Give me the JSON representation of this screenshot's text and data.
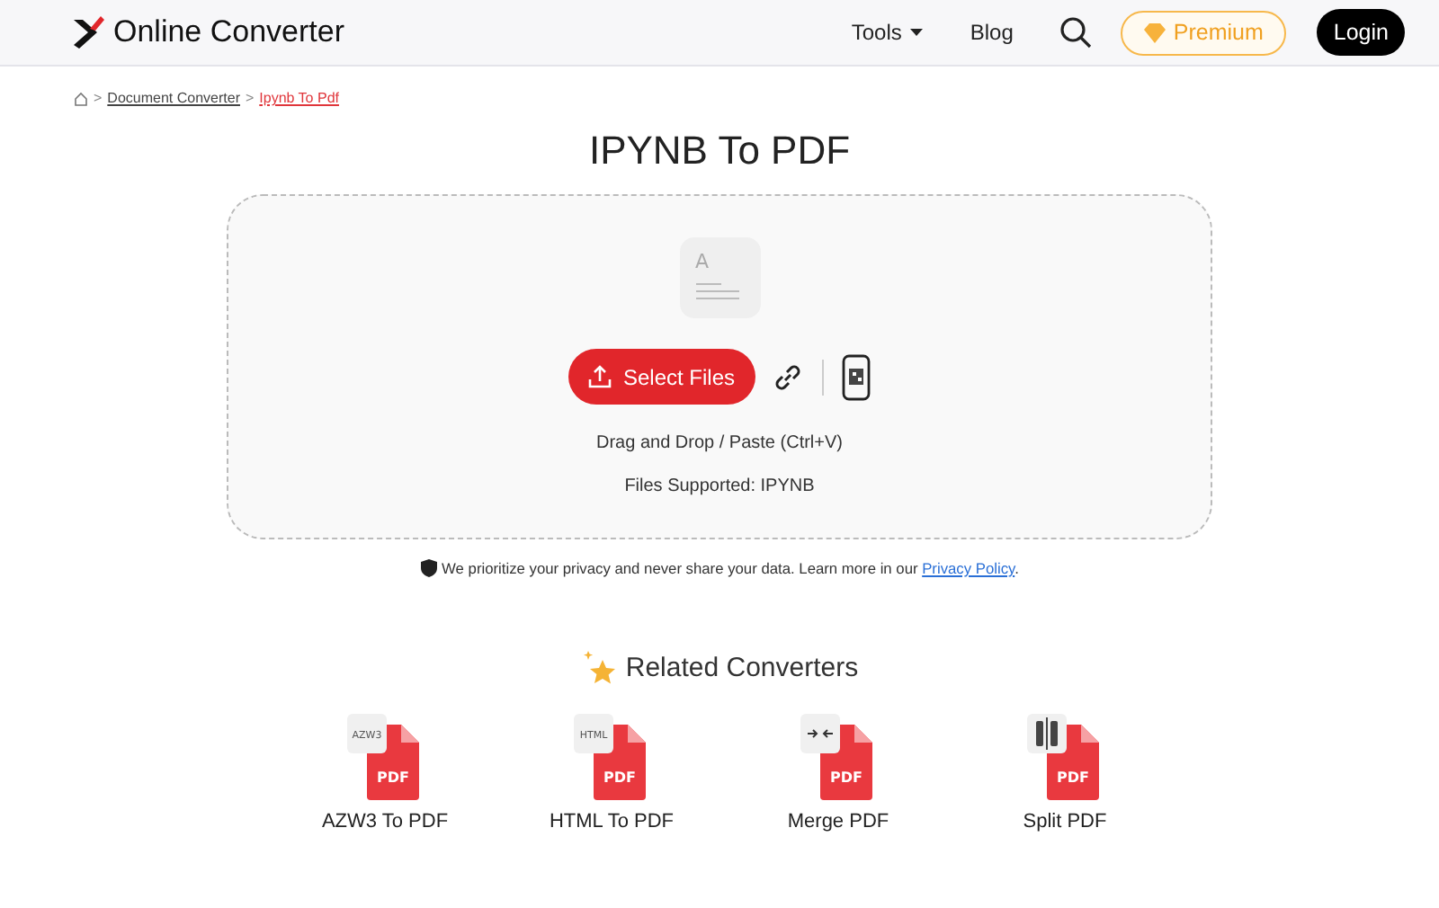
{
  "header": {
    "brand": "Online Converter",
    "nav": [
      {
        "label": "Tools",
        "kind": "dropdown"
      },
      {
        "label": "Blog",
        "kind": "link"
      }
    ],
    "premium": "Premium",
    "login": "Login"
  },
  "breadcrumb": [
    {
      "label": "Document Converter",
      "current": false
    },
    {
      "label": "Ipynb To Pdf",
      "current": true
    }
  ],
  "breadcrumb_separator": ">",
  "title": "IPYNB To PDF",
  "upload": {
    "file_icon_letter": "A",
    "button": "Select Files",
    "hint": "Drag and Drop / Paste (Ctrl+V)",
    "supported": "Files Supported: IPYNB"
  },
  "privacy": {
    "text": "We prioritize your privacy and never share your data. Learn more in our ",
    "link": "Privacy Policy",
    "after": "."
  },
  "related": {
    "title": "Related Converters",
    "items": [
      {
        "kind": "text",
        "badge": "AZW3",
        "doc": "PDF",
        "label": "AZW3 To PDF"
      },
      {
        "kind": "text",
        "badge": "HTML",
        "doc": "PDF",
        "label": "HTML To PDF"
      },
      {
        "kind": "merge",
        "doc": "PDF",
        "label": "Merge PDF"
      },
      {
        "kind": "split",
        "doc": "PDF",
        "label": "Split PDF"
      }
    ]
  }
}
